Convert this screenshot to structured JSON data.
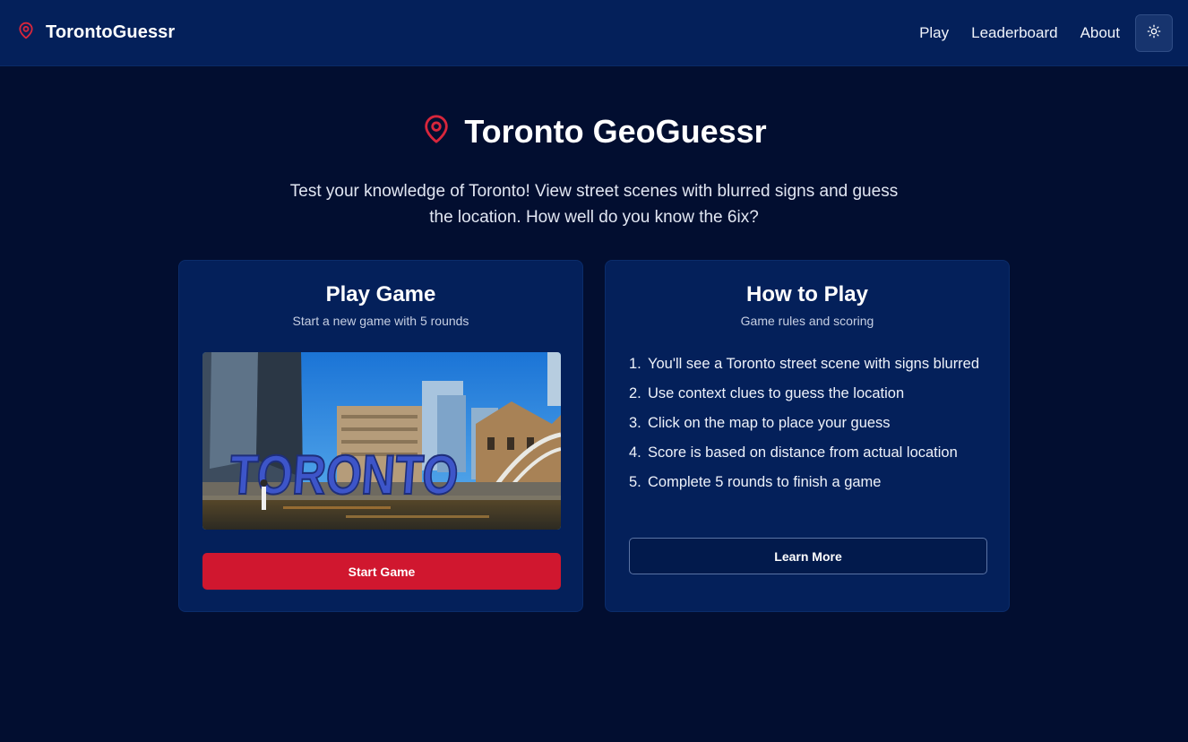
{
  "colors": {
    "background": "#020e30",
    "navbar": "#04205a",
    "card": "#04205a",
    "accent_red": "#d0172f",
    "pin_red": "#d8263c"
  },
  "navbar": {
    "brand_icon": "map-pin-icon",
    "brand_name": "TorontoGuessr",
    "links": [
      "Play",
      "Leaderboard",
      "About"
    ],
    "theme_toggle_icon": "sun-icon"
  },
  "hero": {
    "icon": "map-pin-icon",
    "title": "Toronto GeoGuessr",
    "subtitle": "Test your knowledge of Toronto! View street scenes with blurred signs and guess the location. How well do you know the 6ix?"
  },
  "play_card": {
    "title": "Play Game",
    "subtitle": "Start a new game with 5 rounds",
    "image_sign_text": "TORONTO",
    "button_label": "Start Game"
  },
  "howto_card": {
    "title": "How to Play",
    "subtitle": "Game rules and scoring",
    "rules": [
      {
        "num": "1.",
        "text": "You'll see a Toronto street scene with signs blurred"
      },
      {
        "num": "2.",
        "text": "Use context clues to guess the location"
      },
      {
        "num": "3.",
        "text": "Click on the map to place your guess"
      },
      {
        "num": "4.",
        "text": "Score is based on distance from actual location"
      },
      {
        "num": "5.",
        "text": "Complete 5 rounds to finish a game"
      }
    ],
    "button_label": "Learn More"
  }
}
